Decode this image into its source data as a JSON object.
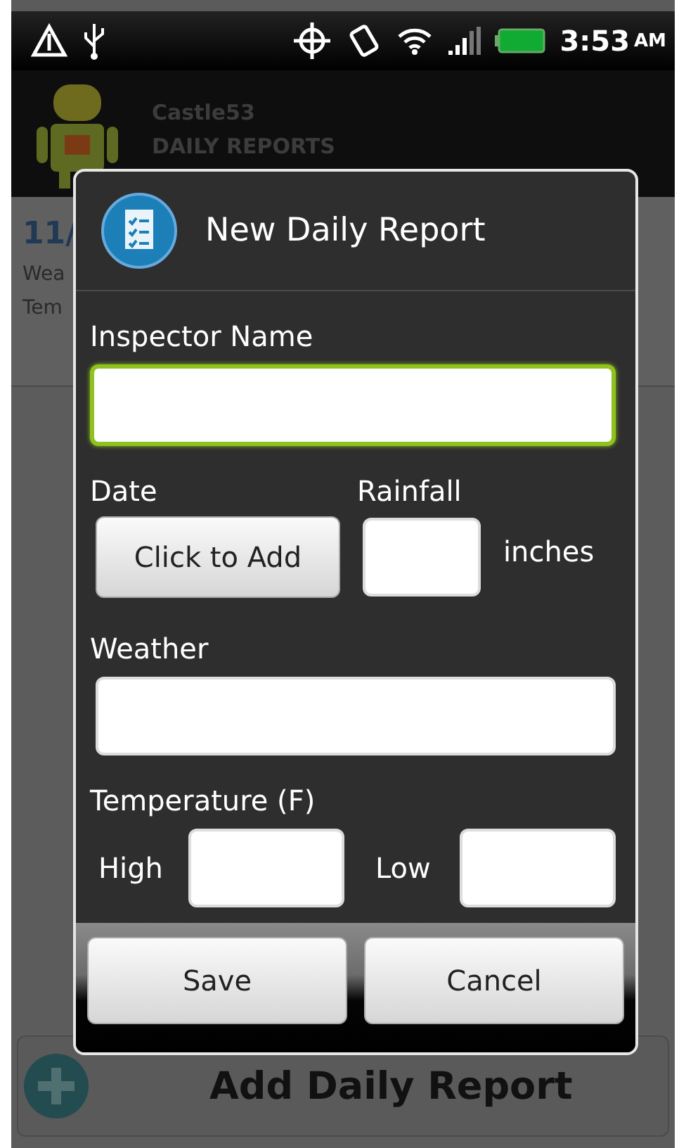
{
  "status_bar": {
    "time": "3:53",
    "meridiem": "AM"
  },
  "app_bar": {
    "title": "Castle53",
    "subtitle": "DAILY REPORTS"
  },
  "list_item": {
    "date": "11/",
    "line_1": "Wea",
    "line_2": "Tem"
  },
  "dialog": {
    "title": "New Daily Report",
    "inspector": {
      "label": "Inspector Name",
      "focused": true
    },
    "date": {
      "label": "Date",
      "button": "Click to Add"
    },
    "rainfall": {
      "label": "Rainfall",
      "unit": "inches"
    },
    "weather": {
      "label": "Weather"
    },
    "temperature": {
      "label": "Temperature (F)",
      "high": "High",
      "low": "Low"
    },
    "buttons": [
      "Save",
      "Cancel"
    ]
  },
  "add_button": {
    "label": "Add Daily Report"
  }
}
